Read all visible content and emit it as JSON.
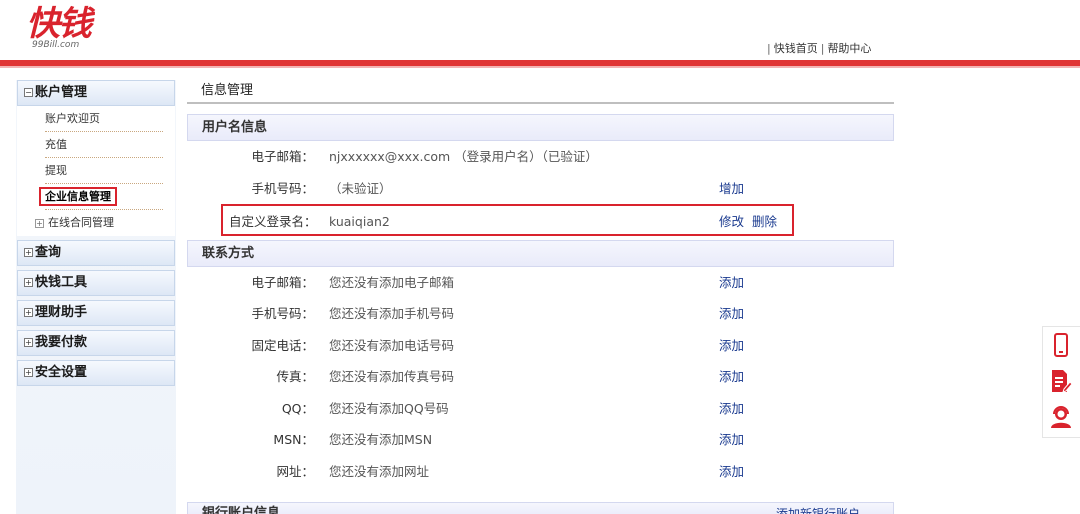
{
  "header": {
    "logo_text": "快钱",
    "logo_sub": "99Bill.com",
    "links": [
      "快钱首页",
      "帮助中心"
    ]
  },
  "sidebar": {
    "sections": [
      {
        "label": "账户管理",
        "expanded": true,
        "items": [
          {
            "label": "账户欢迎页",
            "active": false
          },
          {
            "label": "充值",
            "active": false
          },
          {
            "label": "提现",
            "active": false
          },
          {
            "label": "企业信息管理",
            "active": true
          },
          {
            "label": "在线合同管理",
            "active": false,
            "collapsible": true
          }
        ]
      },
      {
        "label": "查询"
      },
      {
        "label": "快钱工具"
      },
      {
        "label": "理财助手"
      },
      {
        "label": "我要付款"
      },
      {
        "label": "安全设置"
      }
    ]
  },
  "main": {
    "title": "信息管理",
    "username_section": {
      "title": "用户名信息",
      "rows": [
        {
          "label": "电子邮箱：",
          "value": "njxxxxxx@xxx.com （登录用户名）（已验证）",
          "actions": []
        },
        {
          "label": "手机号码：",
          "value": "（未验证）",
          "actions": [
            "增加"
          ]
        },
        {
          "label": "自定义登录名：",
          "value": "kuaiqian2",
          "actions": [
            "修改",
            "删除"
          ],
          "highlighted": true
        }
      ]
    },
    "contact_section": {
      "title": "联系方式",
      "rows": [
        {
          "label": "电子邮箱：",
          "value": "您还没有添加电子邮箱",
          "action": "添加"
        },
        {
          "label": "手机号码：",
          "value": "您还没有添加手机号码",
          "action": "添加"
        },
        {
          "label": "固定电话：",
          "value": "您还没有添加电话号码",
          "action": "添加"
        },
        {
          "label": "传真：",
          "value": "您还没有添加传真号码",
          "action": "添加"
        },
        {
          "label": "QQ：",
          "value": "您还没有添加QQ号码",
          "action": "添加"
        },
        {
          "label": "MSN：",
          "value": "您还没有添加MSN",
          "action": "添加"
        },
        {
          "label": "网址：",
          "value": "您还没有添加网址",
          "action": "添加"
        }
      ]
    },
    "bank_section": {
      "title": "银行账户信息",
      "action": "添加新银行账户"
    }
  },
  "float_icons": [
    "phone-icon",
    "document-edit-icon",
    "customer-service-icon"
  ],
  "colors": {
    "brand_red": "#d9232d",
    "link_blue": "#1a3a8f",
    "section_bg": "#e9ebfa"
  }
}
